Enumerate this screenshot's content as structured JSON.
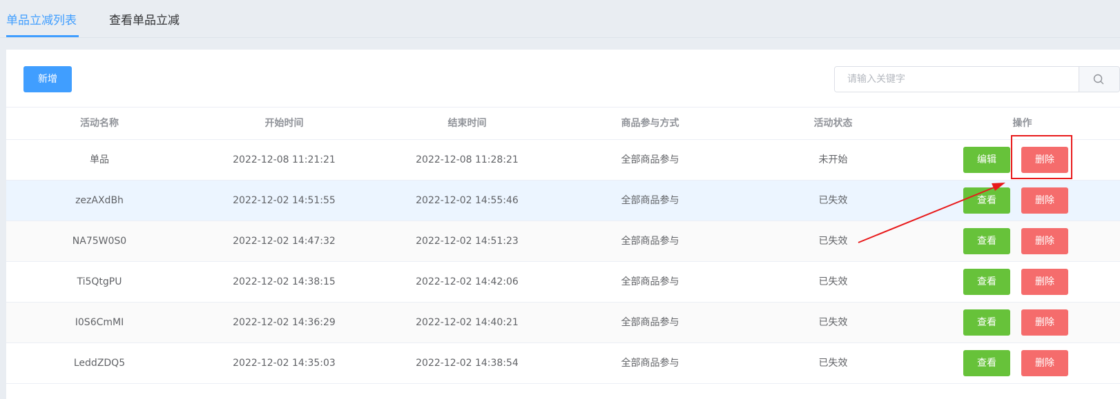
{
  "tabs": [
    {
      "label": "单品立减列表",
      "active": true
    },
    {
      "label": "查看单品立减",
      "active": false
    }
  ],
  "toolbar": {
    "new_label": "新增",
    "search_placeholder": "请输入关键字",
    "search_value": ""
  },
  "table": {
    "headers": [
      "活动名称",
      "开始时间",
      "结束时间",
      "商品参与方式",
      "活动状态",
      "操作"
    ],
    "rows": [
      {
        "name": "单品",
        "start": "2022-12-08 11:21:21",
        "end": "2022-12-08 11:28:21",
        "mode": "全部商品参与",
        "status": "未开始",
        "action1": "编辑",
        "action2": "删除"
      },
      {
        "name": "zezAXdBh",
        "start": "2022-12-02 14:51:55",
        "end": "2022-12-02 14:55:46",
        "mode": "全部商品参与",
        "status": "已失效",
        "action1": "查看",
        "action2": "删除"
      },
      {
        "name": "NA75W0S0",
        "start": "2022-12-02 14:47:32",
        "end": "2022-12-02 14:51:23",
        "mode": "全部商品参与",
        "status": "已失效",
        "action1": "查看",
        "action2": "删除"
      },
      {
        "name": "Ti5QtgPU",
        "start": "2022-12-02 14:38:15",
        "end": "2022-12-02 14:42:06",
        "mode": "全部商品参与",
        "status": "已失效",
        "action1": "查看",
        "action2": "删除"
      },
      {
        "name": "I0S6CmMI",
        "start": "2022-12-02 14:36:29",
        "end": "2022-12-02 14:40:21",
        "mode": "全部商品参与",
        "status": "已失效",
        "action1": "查看",
        "action2": "删除"
      },
      {
        "name": "LeddZDQ5",
        "start": "2022-12-02 14:35:03",
        "end": "2022-12-02 14:38:54",
        "mode": "全部商品参与",
        "status": "已失效",
        "action1": "查看",
        "action2": "删除"
      }
    ]
  },
  "colors": {
    "primary": "#409eff",
    "success": "#67c23a",
    "danger": "#f56c6c",
    "annotation": "#e8191a"
  },
  "icons": {
    "search": "search-icon"
  }
}
